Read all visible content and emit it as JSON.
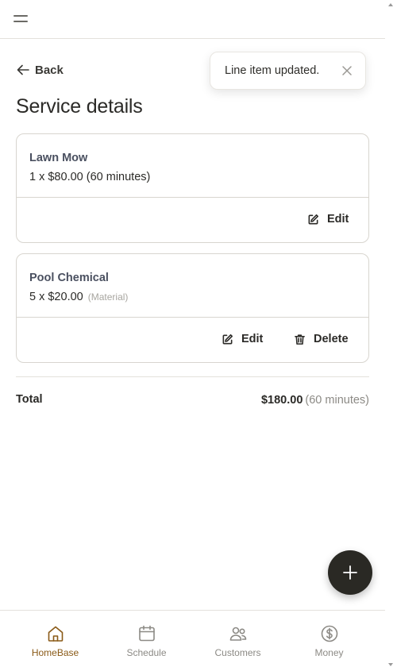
{
  "page": {
    "title": "Service details",
    "back_label": "Back"
  },
  "toast": {
    "message": "Line item updated."
  },
  "line_items": [
    {
      "name": "Lawn Mow",
      "detail": "1 x $80.00 (60 minutes)",
      "tag": "",
      "actions": [
        "Edit"
      ]
    },
    {
      "name": "Pool Chemical",
      "detail": "5 x $20.00",
      "tag": "(Material)",
      "actions": [
        "Edit",
        "Delete"
      ]
    }
  ],
  "total": {
    "label": "Total",
    "amount": "$180.00",
    "duration": "(60 minutes)"
  },
  "bottom_nav": {
    "items": [
      {
        "label": "HomeBase",
        "icon": "home-icon",
        "active": true
      },
      {
        "label": "Schedule",
        "icon": "calendar-icon",
        "active": false
      },
      {
        "label": "Customers",
        "icon": "people-icon",
        "active": false
      },
      {
        "label": "Money",
        "icon": "dollar-circle-icon",
        "active": false
      }
    ]
  },
  "colors": {
    "accent": "#8a5a17",
    "fab": "#2a2924",
    "item_name": "#4a5060",
    "border": "#d8d5cf"
  }
}
